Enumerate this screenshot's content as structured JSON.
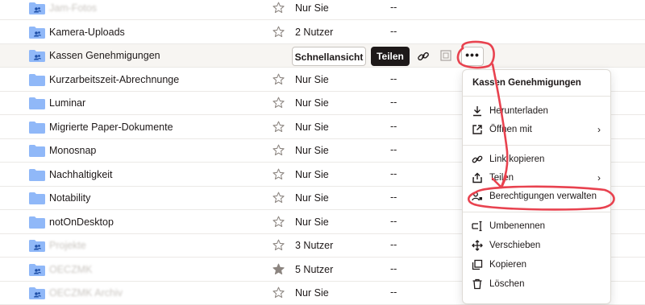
{
  "rows": [
    {
      "name": "Jam-Fotos",
      "blurred": true,
      "shared": true,
      "access": "Nur Sie",
      "modified": "--"
    },
    {
      "name": "Kamera-Uploads",
      "blurred": false,
      "shared": true,
      "access": "2 Nutzer",
      "modified": "--"
    },
    {
      "name": "Kassen Genehmigungen",
      "blurred": false,
      "shared": true,
      "access": "",
      "modified": ""
    },
    {
      "name": "Kurzarbeitszeit-Abrechnunge",
      "blurred": false,
      "shared": false,
      "access": "Nur Sie",
      "modified": "--"
    },
    {
      "name": "Luminar",
      "blurred": false,
      "shared": false,
      "access": "Nur Sie",
      "modified": "--"
    },
    {
      "name": "Migrierte Paper-Dokumente",
      "blurred": false,
      "shared": false,
      "access": "Nur Sie",
      "modified": "--"
    },
    {
      "name": "Monosnap",
      "blurred": false,
      "shared": false,
      "access": "Nur Sie",
      "modified": "--"
    },
    {
      "name": "Nachhaltigkeit",
      "blurred": false,
      "shared": false,
      "access": "Nur Sie",
      "modified": "--"
    },
    {
      "name": "Notability",
      "blurred": false,
      "shared": false,
      "access": "Nur Sie",
      "modified": "--"
    },
    {
      "name": "notOnDesktop",
      "blurred": false,
      "shared": false,
      "access": "Nur Sie",
      "modified": "--"
    },
    {
      "name": "Projekte",
      "blurred": true,
      "shared": true,
      "access": "3 Nutzer",
      "modified": "--"
    },
    {
      "name": "OECZMK",
      "blurred": true,
      "shared": true,
      "access": "5 Nutzer",
      "starred": true,
      "modified": "--"
    },
    {
      "name": "OECZMK Archiv",
      "blurred": true,
      "shared": true,
      "access": "Nur Sie",
      "modified": "--"
    }
  ],
  "hover_actions": {
    "quick_view": "Schnellansicht",
    "share": "Teilen",
    "more": "•••"
  },
  "menu": {
    "title": "Kassen Genehmigungen",
    "items": [
      {
        "label": "Herunterladen",
        "icon": "download-icon"
      },
      {
        "label": "Öffnen mit",
        "icon": "open-external-icon",
        "submenu": true
      },
      {
        "label": "Link kopieren",
        "icon": "link-icon"
      },
      {
        "label": "Teilen",
        "icon": "share-icon",
        "submenu": true
      },
      {
        "label": "Berechtigungen verwalten",
        "icon": "permissions-icon"
      },
      {
        "label": "Umbenennen",
        "icon": "rename-icon"
      },
      {
        "label": "Verschieben",
        "icon": "move-icon"
      },
      {
        "label": "Kopieren",
        "icon": "copy-icon"
      },
      {
        "label": "Löschen",
        "icon": "trash-icon"
      }
    ]
  },
  "colors": {
    "folder": "#90b8f8",
    "annotation": "#e8424f",
    "share_button": "#1e1919"
  }
}
